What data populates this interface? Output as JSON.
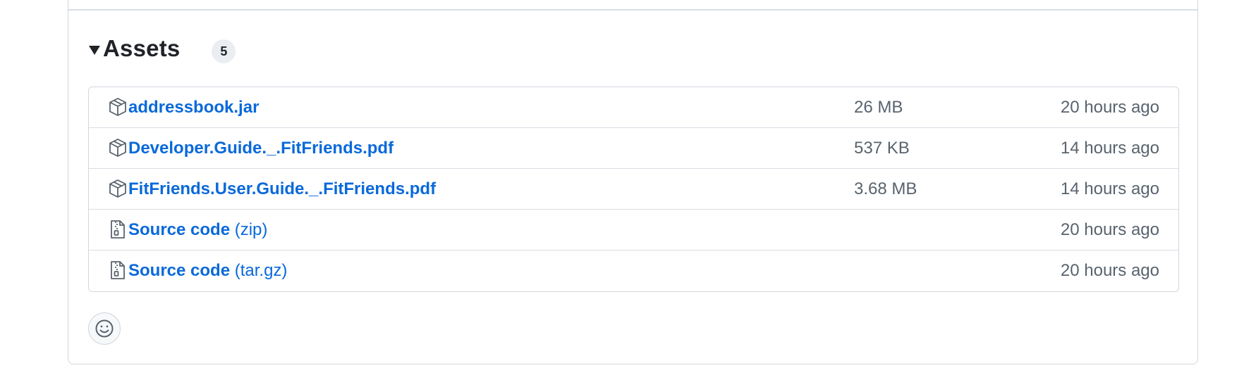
{
  "assets": {
    "title": "Assets",
    "count": "5",
    "items": [
      {
        "name": "addressbook.jar",
        "suffix": "",
        "size": "26 MB",
        "time": "20 hours ago",
        "icon": "package-icon"
      },
      {
        "name": "Developer.Guide._.FitFriends.pdf",
        "suffix": "",
        "size": "537 KB",
        "time": "14 hours ago",
        "icon": "package-icon"
      },
      {
        "name": "FitFriends.User.Guide._.FitFriends.pdf",
        "suffix": "",
        "size": "3.68 MB",
        "time": "14 hours ago",
        "icon": "package-icon"
      },
      {
        "name": "Source code",
        "suffix": "(zip)",
        "size": "",
        "time": "20 hours ago",
        "icon": "file-zip-icon"
      },
      {
        "name": "Source code",
        "suffix": "(tar.gz)",
        "size": "",
        "time": "20 hours ago",
        "icon": "file-zip-icon"
      }
    ]
  },
  "reactions": {
    "icon": "smiley-icon"
  },
  "colors": {
    "link": "#0969da",
    "muted": "#59636e",
    "border": "#d0d7de"
  }
}
